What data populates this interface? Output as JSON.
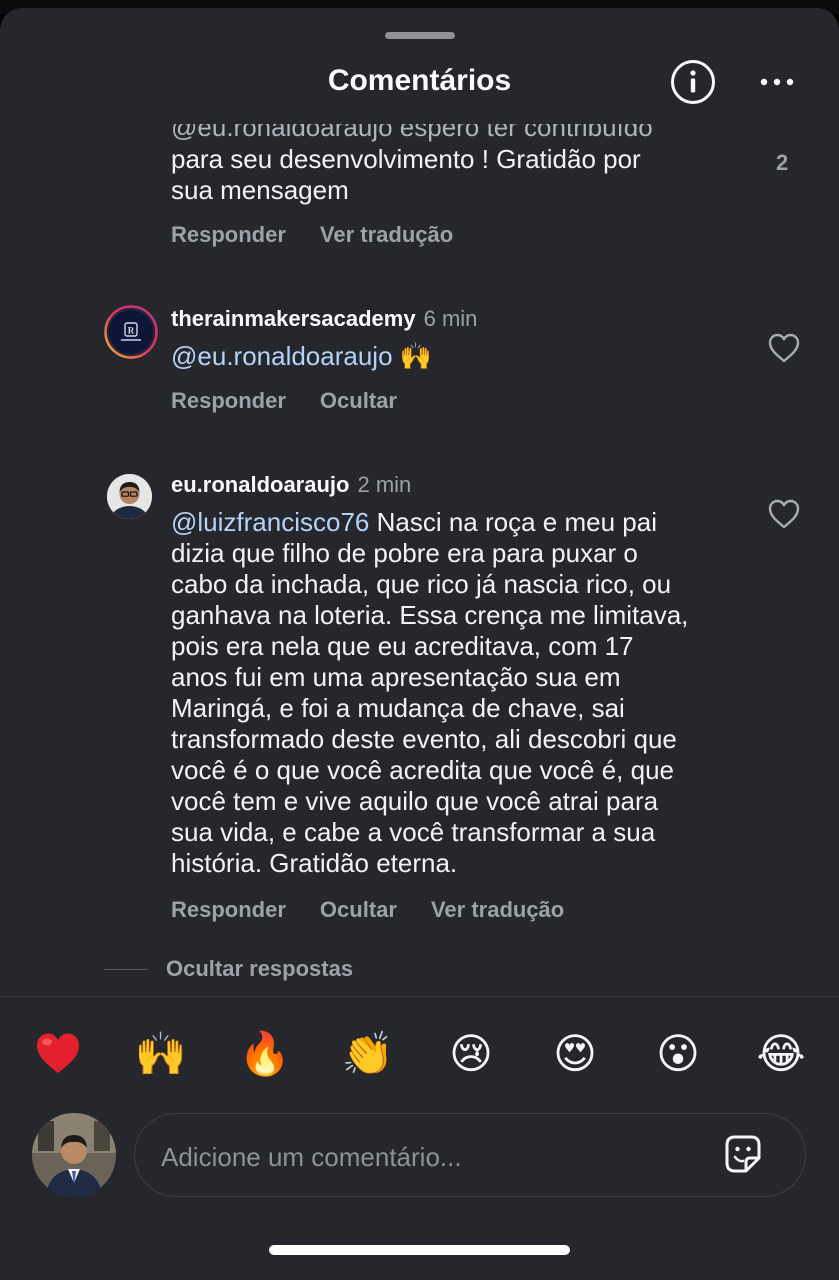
{
  "header": {
    "title": "Comentários",
    "info_icon": "info-circle-icon",
    "more_icon": "more-horizontal-icon"
  },
  "comments": [
    {
      "partial_line": "@eu.ronaldoaraujo espero ter contribuído",
      "lines": [
        "para seu desenvolvimento ! Gratidão por",
        "sua mensagem"
      ],
      "likes": "2",
      "actions": [
        "Responder",
        "Ver tradução"
      ]
    },
    {
      "username": "therainmakersacademy",
      "time": "6 min",
      "mention": "@eu.ronaldoaraujo",
      "text": "🙌",
      "actions": [
        "Responder",
        "Ocultar"
      ]
    },
    {
      "username": "eu.ronaldoaraujo",
      "time": "2 min",
      "mention": "@luizfrancisco76",
      "first_line": "Nasci na roça e meu pai",
      "lines": [
        "dizia que filho de pobre era para puxar o",
        "cabo da inchada, que rico já nascia rico, ou",
        "ganhava na loteria. Essa crença me limitava,",
        "pois era nela que eu acreditava, com 17",
        "anos fui em uma apresentação sua em",
        "Maringá, e foi a mudança de chave, sai",
        "transformado deste evento, ali descobri que",
        "você é o que você acredita que você é, que",
        "você tem e vive aquilo que você atrai para",
        "sua vida, e cabe a você transformar a sua",
        "história. Gratidão eterna."
      ],
      "actions": [
        "Responder",
        "Ocultar",
        "Ver tradução"
      ]
    }
  ],
  "hide_replies": "Ocultar respostas",
  "emoji_bar": [
    "❤️",
    "🙌",
    "🔥",
    "👏",
    "😢",
    "😍",
    "😮",
    "😂"
  ],
  "composer": {
    "placeholder": "Adicione um comentário...",
    "sticker_icon": "sticker-icon"
  },
  "colors": {
    "background": "#25272c",
    "mention": "#b6d2f5",
    "secondary_text": "#9ea1a8"
  }
}
